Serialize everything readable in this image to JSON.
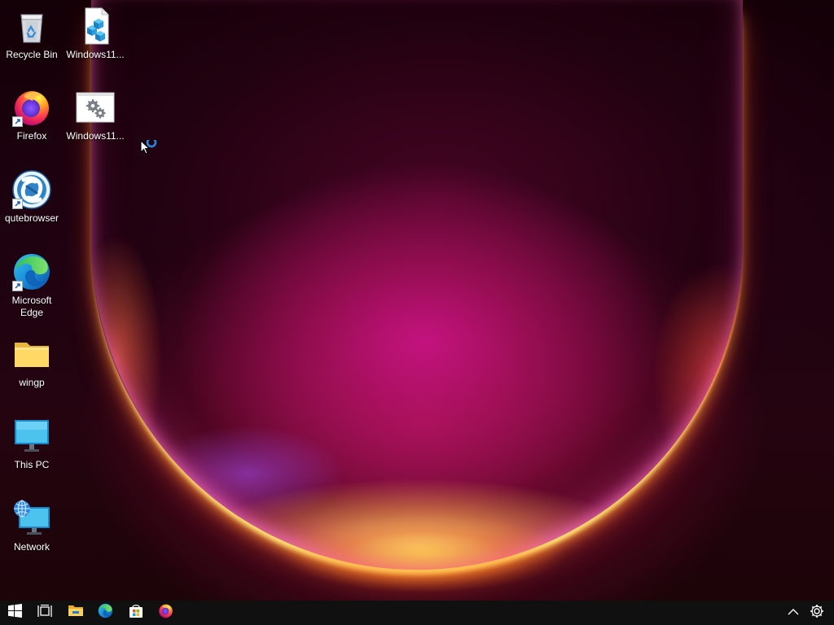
{
  "desktop": {
    "icons": [
      {
        "label": "Recycle Bin",
        "icon": "recycle-bin-icon"
      },
      {
        "label": "Windows11...",
        "icon": "registry-file-icon"
      },
      {
        "label": "Firefox",
        "icon": "firefox-icon"
      },
      {
        "label": "Windows11...",
        "icon": "settings-file-icon"
      },
      {
        "label": "qutebrowser",
        "icon": "qutebrowser-icon"
      },
      {
        "label": "Microsoft Edge",
        "icon": "edge-icon"
      },
      {
        "label": "wingp",
        "icon": "folder-icon"
      },
      {
        "label": "This PC",
        "icon": "monitor-icon"
      },
      {
        "label": "Network",
        "icon": "network-icon"
      }
    ]
  },
  "taskbar": {
    "items": [
      {
        "name": "start-button",
        "icon": "windows-logo-icon"
      },
      {
        "name": "task-view-button",
        "icon": "task-view-icon"
      },
      {
        "name": "file-explorer-button",
        "icon": "folder-icon"
      },
      {
        "name": "edge-button",
        "icon": "edge-icon"
      },
      {
        "name": "store-button",
        "icon": "store-icon"
      },
      {
        "name": "firefox-button",
        "icon": "firefox-icon"
      }
    ],
    "tray": [
      {
        "name": "show-hidden-icons-button",
        "icon": "chevron-up-icon"
      },
      {
        "name": "settings-button",
        "icon": "gear-icon"
      }
    ]
  },
  "colors": {
    "taskbar_bg": "#101010",
    "wallpaper_dark": "#1a0109",
    "wallpaper_magenta": "#c8108a",
    "glow_yellow": "#ffe27a",
    "glow_orange": "#ff6a2a"
  }
}
